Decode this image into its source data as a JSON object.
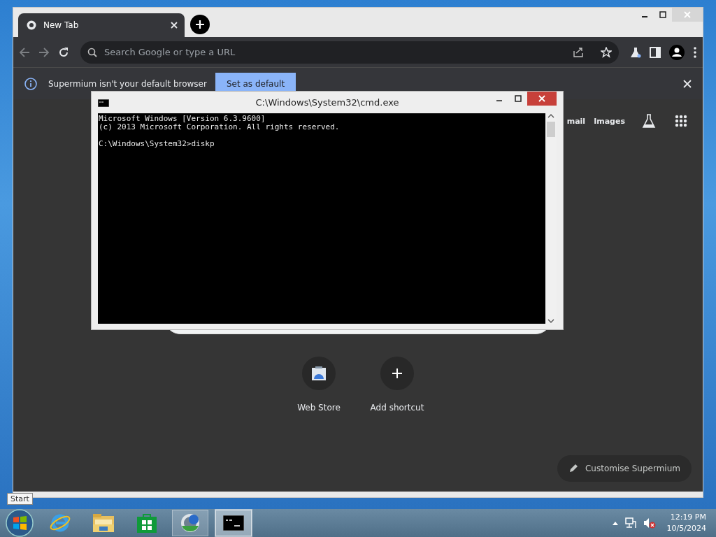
{
  "browser": {
    "tabs": [
      {
        "title": "New Tab",
        "selected": true
      }
    ],
    "address_bar": {
      "placeholder": "Search Google or type a URL"
    },
    "infobar": {
      "message": "Supermium isn't your default browser",
      "button": "Set as default"
    },
    "header_links": [
      "mail",
      "Images"
    ],
    "shortcuts": [
      {
        "label": "Web Store",
        "kind": "store"
      },
      {
        "label": "Add shortcut",
        "kind": "add"
      }
    ],
    "customise_button": "Customise Supermium"
  },
  "console": {
    "title": "C:\\Windows\\System32\\cmd.exe",
    "blocks": [
      [
        "Microsoft Windows [Version 6.3.9600]",
        "(c) 2013 Microsoft Corporation. All rights reserved."
      ],
      [
        "C:\\Windows\\System32>diskp"
      ]
    ]
  },
  "taskbar": {
    "tooltip": "Start",
    "apps": [
      {
        "kind": "ie",
        "running": false,
        "selected": false
      },
      {
        "kind": "explorer",
        "running": false,
        "selected": false
      },
      {
        "kind": "store",
        "running": false,
        "selected": false
      },
      {
        "kind": "browser",
        "running": true,
        "selected": false
      },
      {
        "kind": "console",
        "running": true,
        "selected": true
      }
    ],
    "time": "12:19 PM",
    "date": "10/5/2024"
  }
}
